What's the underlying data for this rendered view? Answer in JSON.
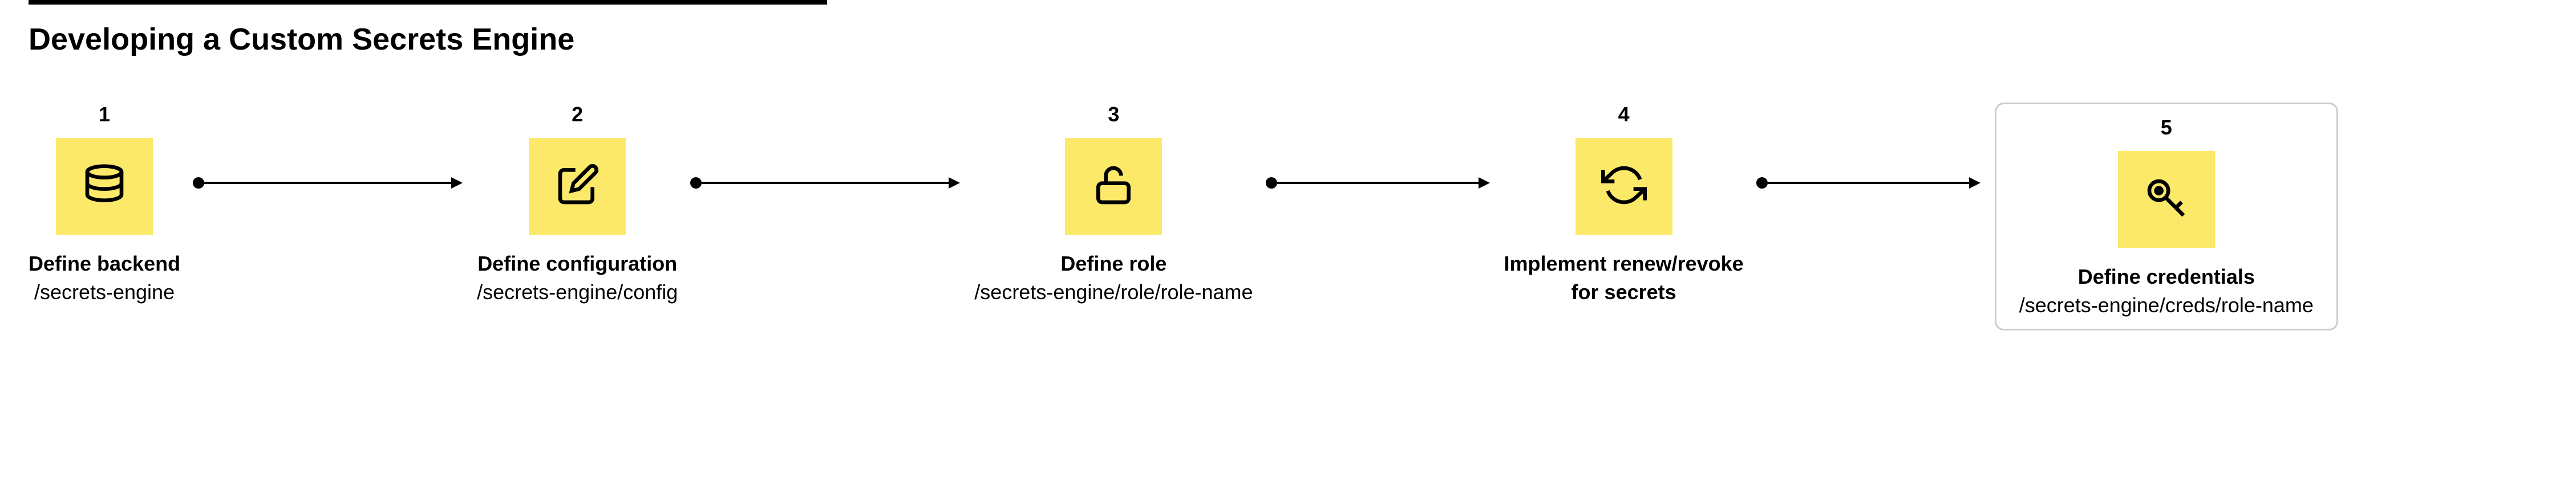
{
  "title": "Developing a Custom Secrets Engine",
  "steps": [
    {
      "num": "1",
      "title": "Define backend",
      "path": "/secrets-engine"
    },
    {
      "num": "2",
      "title": "Define configuration",
      "path": "/secrets-engine/config"
    },
    {
      "num": "3",
      "title": "Define role",
      "path": "/secrets-engine/role/role-name"
    },
    {
      "num": "4",
      "title": "Implement renew/revoke",
      "path": "for secrets"
    },
    {
      "num": "5",
      "title": "Define credentials",
      "path": "/secrets-engine/creds/role-name"
    }
  ]
}
